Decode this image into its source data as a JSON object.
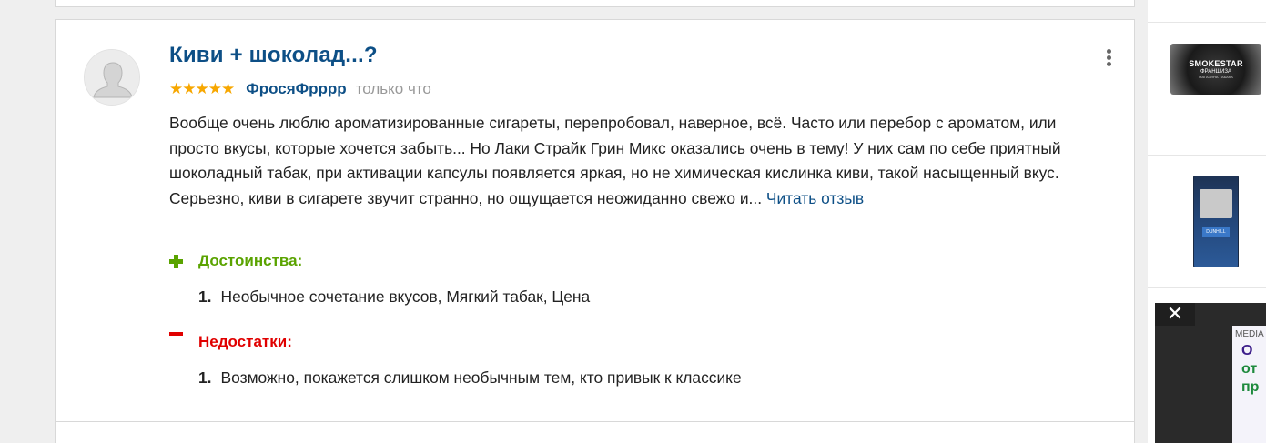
{
  "review": {
    "title": "Киви + шоколад...?",
    "rating": "★★★★★",
    "author": "ФросяФрррр",
    "time": "только что",
    "text": "Вообще очень люблю ароматизированные сигареты, перепробовал, наверное, всё. Часто или перебор с ароматом, или просто вкусы, которые хочется забыть... Но Лаки Страйк Грин Микс оказались очень в тему! У них сам по себе приятный шоколадный табак, при активации капсулы появляется яркая, но не химическая кислинка киви, такой насыщенный вкус. Серьезно, киви в сигарете звучит странно, но ощущается неожиданно свежо и...",
    "read_more": "Читать отзыв",
    "pros": {
      "heading": "Достоинства:",
      "items": [
        {
          "num": "1.",
          "text": "Необычное сочетание вкусов, Мягкий табак, Цена"
        }
      ]
    },
    "cons": {
      "heading": "Недостатки:",
      "items": [
        {
          "num": "1.",
          "text": "Возможно, покажется слишком необычным тем, кто привык к классике"
        }
      ]
    },
    "icons": {
      "avatar": "user-avatar-icon",
      "menu": "more-vertical-icon"
    }
  },
  "sidebar": {
    "thumb1": {
      "line1": "SMOKESTAR",
      "line2": "ФРАНШИЗА",
      "line3": "МАГАЗИНА ТАБАКА"
    },
    "thumb2": {
      "label": "DUNHILL"
    },
    "ad": {
      "close": "✕",
      "media": "MEDIA",
      "line1": "О",
      "line2": "от",
      "line3": "пр"
    }
  },
  "colors": {
    "link": "#0d4f86",
    "stars": "#f7a700",
    "pros": "#5aa300",
    "cons": "#e00000",
    "background": "#efefef"
  }
}
